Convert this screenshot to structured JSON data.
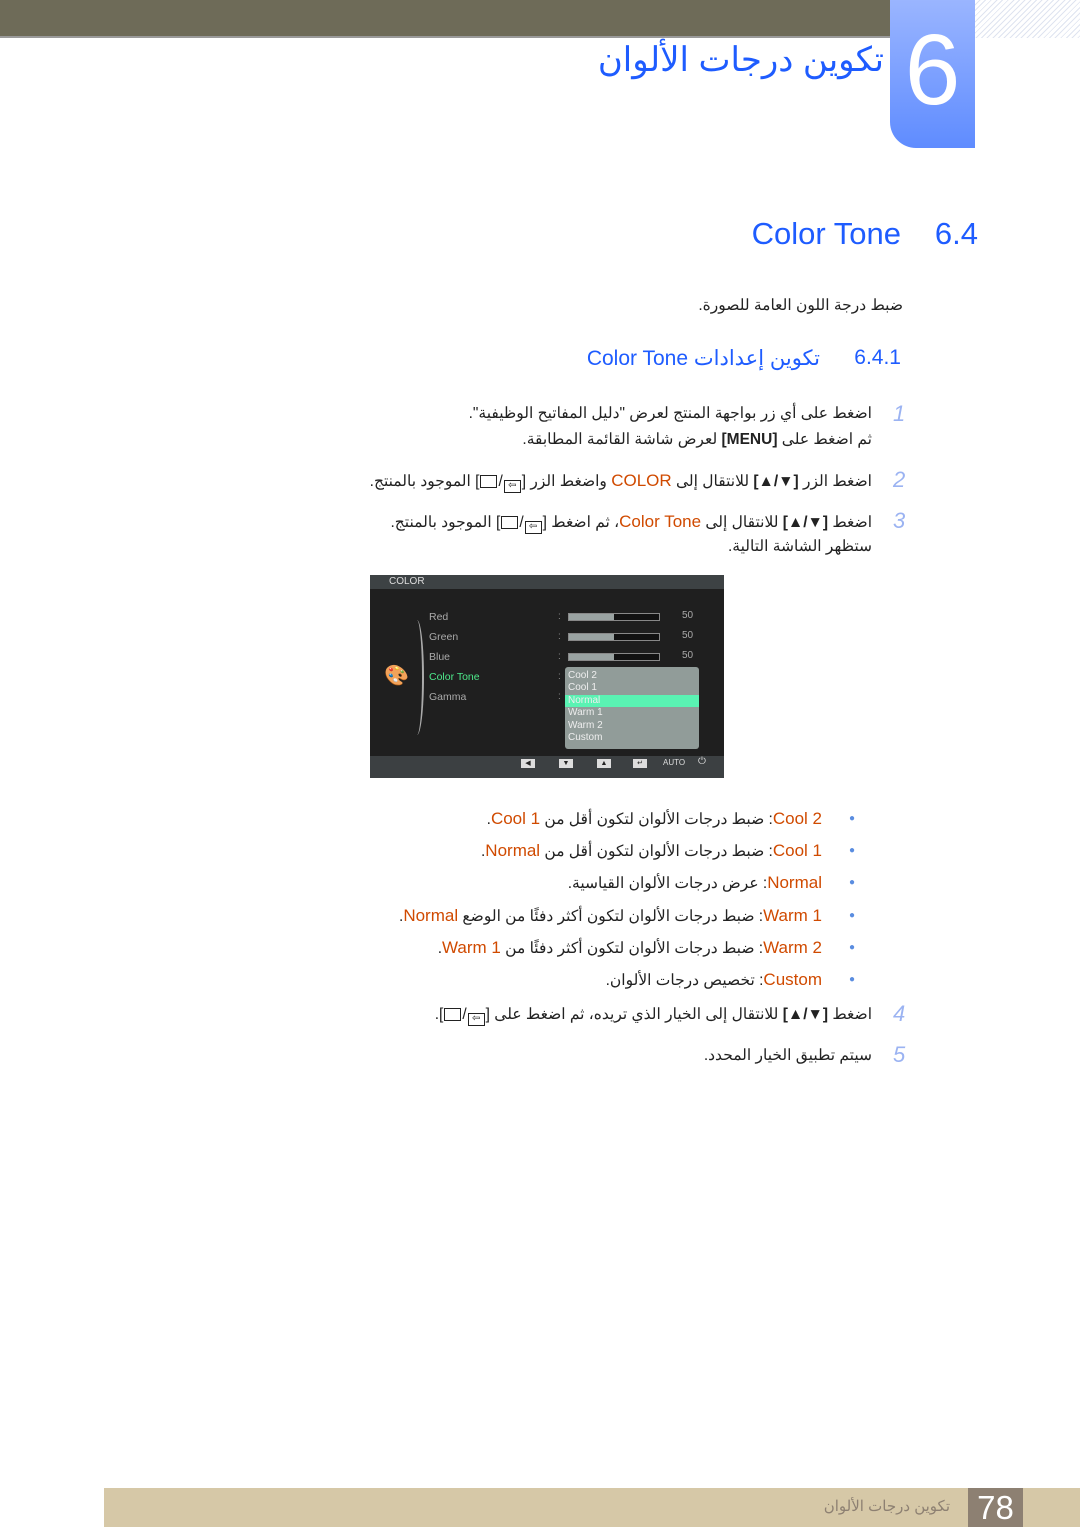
{
  "header": {
    "chapter_number": "6",
    "chapter_title": "تكوين درجات الألوان"
  },
  "section": {
    "number": "6.4",
    "title": "Color Tone",
    "intro": "ضبط درجة اللون العامة للصورة."
  },
  "subsection": {
    "number": "6.4.1",
    "title_ar": "تكوين إعدادات",
    "title_en": "Color Tone"
  },
  "steps": [
    {
      "n": "1",
      "line1": "اضغط على أي زر بواجهة المنتج لعرض \"دليل المفاتيح الوظيفية\".",
      "line2a": "ثم اضغط على ",
      "menu": "[MENU]",
      "line2b": " لعرض شاشة القائمة المطابقة."
    },
    {
      "n": "2",
      "a": "اضغط الزر ",
      "keys": "[▼/▲]",
      "b": " للانتقال إلى ",
      "hl": "COLOR",
      "c": " واضغط الزر ",
      "d": " الموجود بالمنتج."
    },
    {
      "n": "3",
      "a": "اضغط ",
      "keys": "[▼/▲]",
      "b": " للانتقال إلى ",
      "hl": "Color Tone",
      "c": "، ثم اضغط ",
      "d": " الموجود بالمنتج.",
      "line2": "ستظهر الشاشة التالية."
    },
    {
      "n": "4",
      "a": "اضغط ",
      "keys": "[▼/▲]",
      "b": " للانتقال إلى الخيار الذي تريده، ثم اضغط على ",
      "d": "."
    },
    {
      "n": "5",
      "a": "سيتم تطبيق الخيار المحدد."
    }
  ],
  "options": [
    {
      "name": "Cool 2",
      "desc": ": ضبط درجات الألوان لتكون أقل من ",
      "ref": "Cool 1",
      "end": "."
    },
    {
      "name": "Cool 1",
      "desc": ": ضبط درجات الألوان لتكون أقل من ",
      "ref": "Normal",
      "end": "."
    },
    {
      "name": "Normal",
      "desc": ": عرض درجات الألوان القياسية.",
      "ref": "",
      "end": ""
    },
    {
      "name": "Warm 1",
      "desc": ": ضبط درجات الألوان لتكون أكثر دفئًا من الوضع ",
      "ref": "Normal",
      "end": "."
    },
    {
      "name": "Warm 2",
      "desc": ": ضبط درجات الألوان لتكون أكثر دفئًا من ",
      "ref": "Warm 1",
      "end": "."
    },
    {
      "name": "Custom",
      "desc": ": تخصيص درجات الألوان.",
      "ref": "",
      "end": ""
    }
  ],
  "osd": {
    "title": "COLOR",
    "items": [
      {
        "label": "Red",
        "value": "50",
        "level": 0.5
      },
      {
        "label": "Green",
        "value": "50",
        "level": 0.5
      },
      {
        "label": "Blue",
        "value": "50",
        "level": 0.5
      },
      {
        "label": "Color Tone"
      },
      {
        "label": "Gamma"
      }
    ],
    "dropdown": [
      "Cool 2",
      "Cool 1",
      "Normal",
      "Warm 1",
      "Warm 2",
      "Custom"
    ],
    "selected": "Normal",
    "auto": "AUTO",
    "active_color": "#4de88a",
    "highlight_color": "#5af3b3"
  },
  "footer": {
    "page": "78",
    "chapter": "تكوين درجات الألوان"
  },
  "colors": {
    "accent": "#1e5cff",
    "highlight": "#d04a00"
  }
}
